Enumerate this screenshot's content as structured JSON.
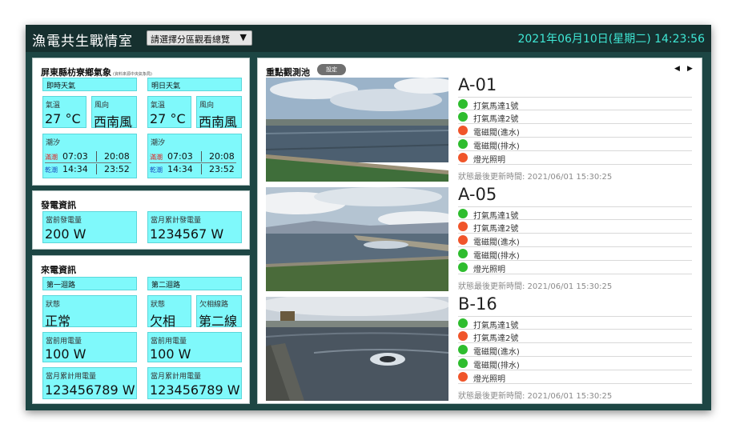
{
  "header": {
    "title": "漁電共生戰情室",
    "zone_select": "請選擇分區觀看總覽",
    "datetime": "2021年06月10日(星期二) 14:23:56"
  },
  "weather": {
    "title": "屏東縣枋寮鄉氣象",
    "source": "(資料來源中央氣象局)",
    "current": {
      "label": "即時天氣",
      "temp_label": "氣溫",
      "temp": "27 °C",
      "wind_label": "風向",
      "wind": "西南風",
      "tide_label": "潮汐",
      "high_label": "滿潮",
      "high_1": "07:03",
      "high_2": "20:08",
      "low_label": "乾潮",
      "low_1": "14:34",
      "low_2": "23:52"
    },
    "tomorrow": {
      "label": "明日天氣",
      "temp_label": "氣溫",
      "temp": "27 °C",
      "wind_label": "風向",
      "wind": "西南風",
      "tide_label": "潮汐",
      "high_label": "滿潮",
      "high_1": "07:03",
      "high_2": "20:08",
      "low_label": "乾潮",
      "low_1": "14:34",
      "low_2": "23:52"
    }
  },
  "generation": {
    "title": "發電資訊",
    "current_label": "當前發電量",
    "current_value": "200 W",
    "monthly_label": "當月累計發電量",
    "monthly_value": "1234567 W"
  },
  "consumption": {
    "title": "來電資訊",
    "circuit1": {
      "label": "第一迴路",
      "status_label": "狀態",
      "status": "正常",
      "current_label": "當前用電量",
      "current": "100 W",
      "monthly_label": "當月累計用電量",
      "monthly": "123456789 W"
    },
    "circuit2": {
      "label": "第二迴路",
      "status_label": "狀態",
      "status": "欠相",
      "phase_label": "欠相線路",
      "phase": "第二線",
      "current_label": "當前用電量",
      "current": "100 W",
      "monthly_label": "當月累計用電量",
      "monthly": "123456789 W"
    }
  },
  "monitor": {
    "title": "重點觀測池",
    "settings_button": "設定",
    "prev_icon": "◀",
    "next_icon": "▶",
    "ponds": [
      {
        "name": "A-01",
        "devices": [
          {
            "label": "打氣馬達1號",
            "status_color": "#2ebd2e"
          },
          {
            "label": "打氣馬達2號",
            "status_color": "#2ebd2e"
          },
          {
            "label": "電磁閥(進水)",
            "status_color": "#f0552a"
          },
          {
            "label": "電磁閥(排水)",
            "status_color": "#2ebd2e"
          },
          {
            "label": "燈光照明",
            "status_color": "#f0552a"
          }
        ],
        "updated": "狀態最後更新時間: 2021/06/01 15:30:25"
      },
      {
        "name": "A-05",
        "devices": [
          {
            "label": "打氣馬達1號",
            "status_color": "#2ebd2e"
          },
          {
            "label": "打氣馬達2號",
            "status_color": "#f0552a"
          },
          {
            "label": "電磁閥(進水)",
            "status_color": "#f0552a"
          },
          {
            "label": "電磁閥(排水)",
            "status_color": "#2ebd2e"
          },
          {
            "label": "燈光照明",
            "status_color": "#2ebd2e"
          }
        ],
        "updated": "狀態最後更新時間: 2021/06/01 15:30:25"
      },
      {
        "name": "B-16",
        "devices": [
          {
            "label": "打氣馬達1號",
            "status_color": "#2ebd2e"
          },
          {
            "label": "打氣馬達2號",
            "status_color": "#f0552a"
          },
          {
            "label": "電磁閥(進水)",
            "status_color": "#2ebd2e"
          },
          {
            "label": "電磁閥(排水)",
            "status_color": "#2ebd2e"
          },
          {
            "label": "燈光照明",
            "status_color": "#f0552a"
          }
        ],
        "updated": "狀態最後更新時間: 2021/06/01 15:30:25"
      }
    ]
  }
}
